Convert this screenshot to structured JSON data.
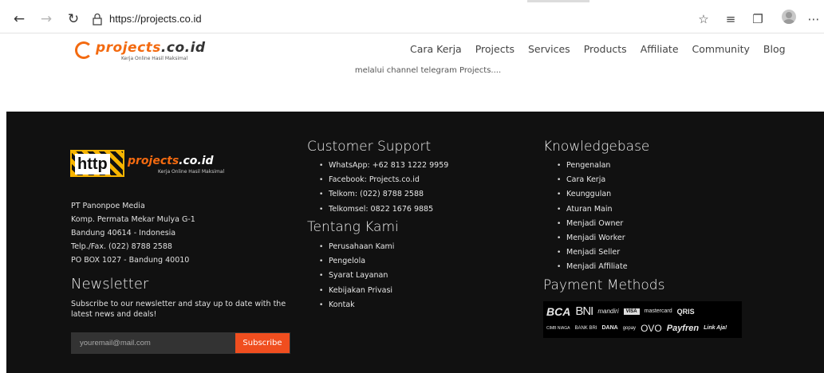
{
  "browser": {
    "url": "https://projects.co.id"
  },
  "site": {
    "logo_text_main": "projects",
    "logo_text_tld": ".co.id",
    "logo_tagline": "Kerja Online Hasil Maksimal",
    "nav": [
      "Cara Kerja",
      "Projects",
      "Services",
      "Products",
      "Affiliate",
      "Community",
      "Blog"
    ],
    "teaser": "melalui channel telegram Projects...."
  },
  "footer": {
    "logo_http": "http",
    "logo_brand_main": "projects",
    "logo_brand_tld": ".co.id",
    "logo_tagline": "Kerja Online Hasil Maksimal",
    "address": [
      "PT Panonpoe Media",
      "Komp. Permata Mekar Mulya G-1",
      "Bandung 40614 - Indonesia",
      "Telp./Fax. (022) 8788 2588",
      "PO BOX 1027 - Bandung 40010"
    ],
    "newsletter": {
      "title": "Newsletter",
      "description": "Subscribe to our newsletter and stay up to date with the latest news and deals!",
      "placeholder": "youremail@mail.com",
      "button": "Subscribe"
    },
    "customer_support": {
      "title": "Customer Support",
      "items": [
        "WhatsApp: +62 813 1222 9959",
        "Facebook: Projects.co.id",
        "Telkom: (022) 8788 2588",
        "Telkomsel: 0822 1676 9885"
      ]
    },
    "tentang_kami": {
      "title": "Tentang Kami",
      "items": [
        "Perusahaan Kami",
        "Pengelola",
        "Syarat Layanan",
        "Kebijakan Privasi",
        "Kontak"
      ]
    },
    "knowledgebase": {
      "title": "Knowledgebase",
      "items": [
        "Pengenalan",
        "Cara Kerja",
        "Keunggulan",
        "Aturan Main",
        "Menjadi Owner",
        "Menjadi Worker",
        "Menjadi Seller",
        "Menjadi Affiliate"
      ]
    },
    "payment": {
      "title": "Payment Methods",
      "row1": [
        "BCA",
        "BNI",
        "mandiri",
        "VISA",
        "mastercard",
        "QRIS"
      ],
      "row2": [
        "CIMB NIAGA",
        "BANK BRI",
        "DANA",
        "gopay",
        "OVO",
        "Payfren",
        "Link Aja!"
      ]
    }
  },
  "colors": {
    "accent": "#f04e1f",
    "footer_bg": "#111111"
  }
}
